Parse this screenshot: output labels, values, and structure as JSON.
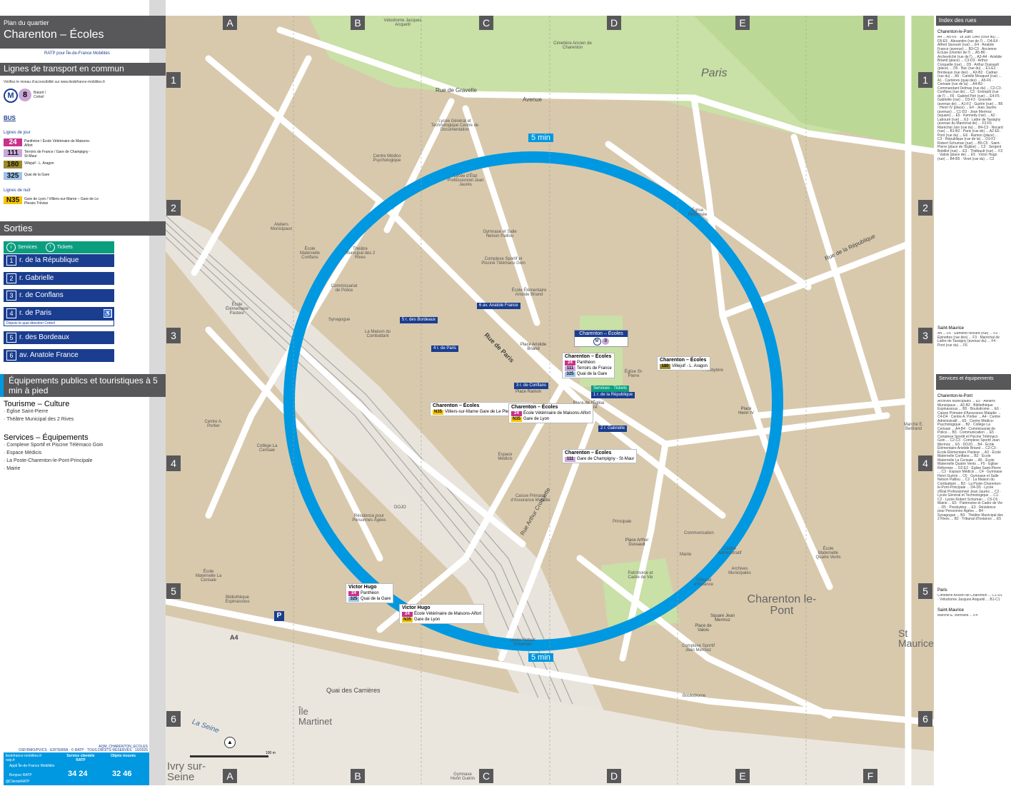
{
  "header": {
    "subtitle": "Plan du quartier",
    "title": "Charenton – Écoles",
    "logos": "RATP pour Île-de-France Mobilités"
  },
  "transport": {
    "heading": "Lignes de transport en commun",
    "access_note": "Vérifiez le niveau d'accessibilité sur www.iledefrance-mobilites.fr",
    "metro_line": "8",
    "metro_dest": "Balard / Créteil",
    "bus_label": "BUS",
    "day_label": "Lignes de jour",
    "night_label": "Lignes de nuit",
    "day_lines": [
      {
        "num": "24",
        "color": "#c9328b",
        "text": "Panthéon / École Vétérinaire de Maisons-Alfort"
      },
      {
        "num": "111",
        "color": "#c9a7d9",
        "text": "Terroirs de France / Gare de Champigny - St-Maur"
      },
      {
        "num": "180",
        "color": "#9b8a2a",
        "text": "Villejuif - L. Aragon"
      },
      {
        "num": "325",
        "color": "#9fc2e7",
        "text": "Quai de la Gare"
      }
    ],
    "night_lines": [
      {
        "num": "N35",
        "color": "#f5c400",
        "text": "Gare de Lyon / Villiers-sur-Marne – Gare de Le Plessis Trévise"
      }
    ]
  },
  "exits": {
    "heading": "Sorties",
    "services_label": "Services",
    "tickets_label": "Tickets",
    "items": [
      {
        "num": "1",
        "label": "r. de la République"
      },
      {
        "num": "2",
        "label": "r. Gabrielle"
      },
      {
        "num": "3",
        "label": "r. de Conflans"
      },
      {
        "num": "4",
        "label": "r. de Paris",
        "note": "Depuis le quai direction Créteil"
      },
      {
        "num": "5",
        "label": "r. des Bordeaux"
      },
      {
        "num": "6",
        "label": "av. Anatole France"
      }
    ]
  },
  "equipments": {
    "heading": "Équipements publics et touristiques à 5 min à pied",
    "tourism_title": "Tourisme – Culture",
    "tourism": [
      "· Église Saint-Pierre",
      "· Théâtre Municipal des 2 Rives"
    ],
    "services_title": "Services – Équipements",
    "services": [
      "· Complexe Sportif et Piscine Télémaco Goin",
      "· Espace Médicis",
      "· La Poste-Charenton-le-Pont-Principale",
      "· Mairie"
    ]
  },
  "footer": {
    "ref": "AQM_CHARENTON_ECOLES",
    "credits": "DSF/DMO/PV/CS · EDITERRA · © RATP · TOUS DROITS RÉSERVÉS · 10/2025",
    "site1": "iledefrance-mobilites.fr",
    "site2": "ratp.fr",
    "app1": "Appli Île-de-France Mobilités",
    "app2": "Bonjour RATP",
    "handle": "@ClientsRATP",
    "service_title": "Service clientèle RATP",
    "service_phone": "34 24",
    "objects_title": "Objets trouvés",
    "objects_phone": "32 46",
    "scale": "100 m"
  },
  "grid": {
    "columns": [
      "A",
      "B",
      "C",
      "D",
      "E",
      "F"
    ],
    "rows": [
      "1",
      "2",
      "3",
      "4",
      "5",
      "6"
    ]
  },
  "map_labels": {
    "circle": "5 min",
    "paris": "Paris",
    "charenton": "Charenton le-Pont",
    "stmaurice": "St Maurice",
    "ivry": "Ivry sur-Seine",
    "ile": "Île Martinet",
    "seine": "La Seine",
    "streets": [
      "Rue de Paris",
      "Rue de Gravelle",
      "Avenue",
      "Rue Victor Hugo",
      "Quai des Carrières",
      "A4",
      "Rue Arthur Croquette",
      "Rue de la République",
      "Rue Gabrielle",
      "Rue de Conflans",
      "Rue du Maréchal Juin",
      "Rue du Sergent",
      "Av. Marechal de Lattre de Tassigny",
      "Rue de Saint Pierre",
      "Rue des Bordeaux",
      "Passerelle"
    ],
    "places": [
      "Place Aristide Briand",
      "Place Ramon",
      "Place de l'Église St-Pierre",
      "Place Henri IV",
      "Place Arthur Dussault",
      "Square Jean Mermoz",
      "Place de Valois"
    ],
    "pois": [
      "Vélodrome Jacques Anquetil",
      "Cimetière Ancien de Charenton",
      "Lycée Général et Technologique Centre de Documentation",
      "Lycée d'État Professionnel Jean Jaurès",
      "Centre Médico Psychologique",
      "Gymnase et Salle Nelson Paillou",
      "Complexe Sportif et Piscine Télémaco Goin",
      "École Élémentaire Aristide Briand",
      "Ateliers Municipaux",
      "École Maternelle Conflans",
      "Théâtre Municipal des 2 Rives",
      "Commissariat de Police",
      "Synagogue",
      "La Maison du Combattant",
      "École Élémentaire Pasteur",
      "Église Réformée",
      "Église St-Pierre",
      "Presbytère",
      "Centre A. Portier",
      "Collège La Cerisaie",
      "Espace Médicis",
      "Caisse Primaire d'Assurance Maladie",
      "Résidence pour Personnes Âgées",
      "DOJO",
      "Principale",
      "Communication",
      "Centre Administratif",
      "Archives Municipales",
      "Mairie",
      "Tribunal d'Instance",
      "Patrimoine et Cadre de Vie",
      "École Maternelle La Cerisaie",
      "Bibliothèque Espinassous",
      "Lycée Robert Schuman",
      "Complexe Sportif Jean Mermoz",
      "Boulodrome",
      "Gymnase Henri Guérin",
      "École Maternelle Quatre Vents",
      "Marché E. Bertrand"
    ]
  },
  "stops": [
    {
      "name": "Charenton – Écoles",
      "lines": [
        {
          "num": "24",
          "text": "Panthéon"
        },
        {
          "num": "111",
          "text": "Terroirs de France"
        },
        {
          "num": "325",
          "text": "Quai de la Gare"
        }
      ]
    },
    {
      "name": "Charenton – Écoles",
      "lines": [
        {
          "num": "180",
          "text": "Villejuif - L. Aragon"
        }
      ]
    },
    {
      "name": "Charenton – Écoles",
      "lines": [
        {
          "num": "N35",
          "text": "Villiers-sur-Marne Gare de Le Plessis-Trévise"
        }
      ]
    },
    {
      "name": "Charenton – Écoles",
      "lines": [
        {
          "num": "24",
          "text": "École Vétérinaire de Maisons-Alfort"
        },
        {
          "num": "N35",
          "text": "Gare de Lyon"
        }
      ]
    },
    {
      "name": "Charenton – Écoles",
      "lines": [
        {
          "num": "111",
          "text": "Gare de Champigny - St-Maur"
        }
      ]
    },
    {
      "name": "Victor Hugo",
      "lines": [
        {
          "num": "24",
          "text": "Panthéon"
        },
        {
          "num": "325",
          "text": "Quai de la Gare"
        }
      ]
    },
    {
      "name": "Victor Hugo",
      "lines": [
        {
          "num": "24",
          "text": "École Vétérinaire de Maisons-Alfort"
        },
        {
          "num": "N35",
          "text": "Gare de Lyon"
        }
      ]
    }
  ],
  "metro_stop": "Charenton – Écoles",
  "index": {
    "heading": "Index des rues",
    "town1": "Charenton-le-Pont",
    "streets": "A4 ... A5-F6 · 18 Juin 1940 (cour du) ... D5-E5 · Alexandre (rue de l') ... D4-E4 · Alfred Savouré (rue) ... E4 · Anatole France (avenue) ... B3-C3 · Ancienne Écluse (chemin de l') ... A5-B6 · Archevêché (rue de l') ... A3-A4 · Aristide Briand (place) ... C3-D3 · Arthur Croquette (rue) ... D5 · Arthur Dussault (place) ... D5 · Bac (rue du) ... E1-E2 · Bordeaux (rue des) ... A3-B2 · Cadran (rue du) ... A5 · Camille Mouquet (rue) ... A1 · Carrières (quai des) ... A5-F6 · Cerisaie (rue de la) ... A4-B3 · Commandant Delmas (rue du) ... C2-C3 · Conflans (rue de) ... C3 · Entrepôt (rue de l') ... F6 · Gabriel Péri (rue) ... E4-F5 · Gabrielle (rue) ... D3-F3 · Gravelle (avenue de) ... A1-F2 · Guérin (rue) ... B5 · Henri IV (place) ... E4 · Jean Jaurès (avenue) ... C1-D3 · Jean Mermoz (square) ... E5 · Kennedy (rue) ... A2 · Labouré (rue) ... E3 · Lattre de Tassigny (avenue du Maréchal de) ... F2-F6 · Maréchal Juin (rue du) ... B4-C3 · Nocard (rue) ... B1-B2 · Paris (rue de) ... A2-E5 · Pont (rue du) ... E6 · Ramon (place) ... C3 · République (rue de la) ... D3-F2 · Robert Schuman (rue) ... B5-C5 · Saint-Pierre (place de l'Église) ... C3 · Sergent Bobillot (rue) ... E3 · Thiébault (rue) ... F3 · Valois (place de) ... E5 · Victor Hugo (rue) ... B4-B5 · Vinet (rue du) ... C2",
    "town2": "Saint-Maurice",
    "streets2": "A4 ... F6 · Edmond Nocard (rue) ... F3 · Épinettes (rue des) ... F3 · Maréchal de Lattre de Tassigny (avenue du) ... F4 · Pont (rue du) ... F6",
    "equip_heading": "Services et équipements",
    "town3": "Charenton-le-Pont",
    "equip": "Archives Municipales ... E5 · Ateliers Municipaux ... A2-B2 · Bibliothèque Espinassous ... B5 · Boulodrome ... E6 · Caisse Primaire d'Assurance Maladie ... C4-D4 · Centre A. Portier ... A4 · Centre Administratif ... E5 · Centre Médico-Psychologique ... B2 · Collège La Cerisaie ... A4-B4 · Commissariat de Police ... B3 · Communication ... E5 · Complexe Sportif et Piscine Télémaco Goin ... C2-C3 · Complexe Sportif Jean Mermoz ... E5 · DOJO ... B4 · École Élémentaire Aristide Briand ... C2-C3 · École Élémentaire Pasteur ... A3 · École Maternelle Conflans ... B2 · École Maternelle La Cerisaie ... A5 · École Maternelle Quatre Vents ... F5 · Église Réformée ... D2-E2 · Église Saint-Pierre ... C3 · Espace Médicis ... C4 · Gymnase Henri Guérin ... C6 · Gymnase et Salle Nelson Paillou ... C2 · La Maison du Combattant ... B3 · La Poste-Charenton-le-Pont-Principale ... D4-D5 · Lycée d'État Professionnel Jean Jaurès ... C2 · Lycée Général et Technologique ... C1-C2 · Lycée Robert Schuman ... C5-C6 · Mairie ... E5 · Patrimoine et Cadre de Vie ... D5 · Presbytère ... E3 · Résidence pour Personnes Âgées ... B4 · Synagogue ... B3 · Théâtre Municipal des 2 Rives ... B2 · Tribunal d'Instance ... E5",
    "town4": "Paris",
    "equip2": "Cimetière Ancien de Charenton ... C1-D1 · Vélodrome Jacques Anquetil ... B1-C1",
    "town5": "Saint-Maurice",
    "equip3": "Marché E. Bertrand ... F4"
  },
  "colors": {
    "header": "#58585a",
    "exit": "#1a3d8f",
    "circle": "#0098e0",
    "services": "#0a9e7f",
    "metro8": "#c9a7d9",
    "park": "#c9e0a6",
    "block": "#d8c9ad",
    "road": "#ffffff",
    "water": "#a9cfe9"
  }
}
